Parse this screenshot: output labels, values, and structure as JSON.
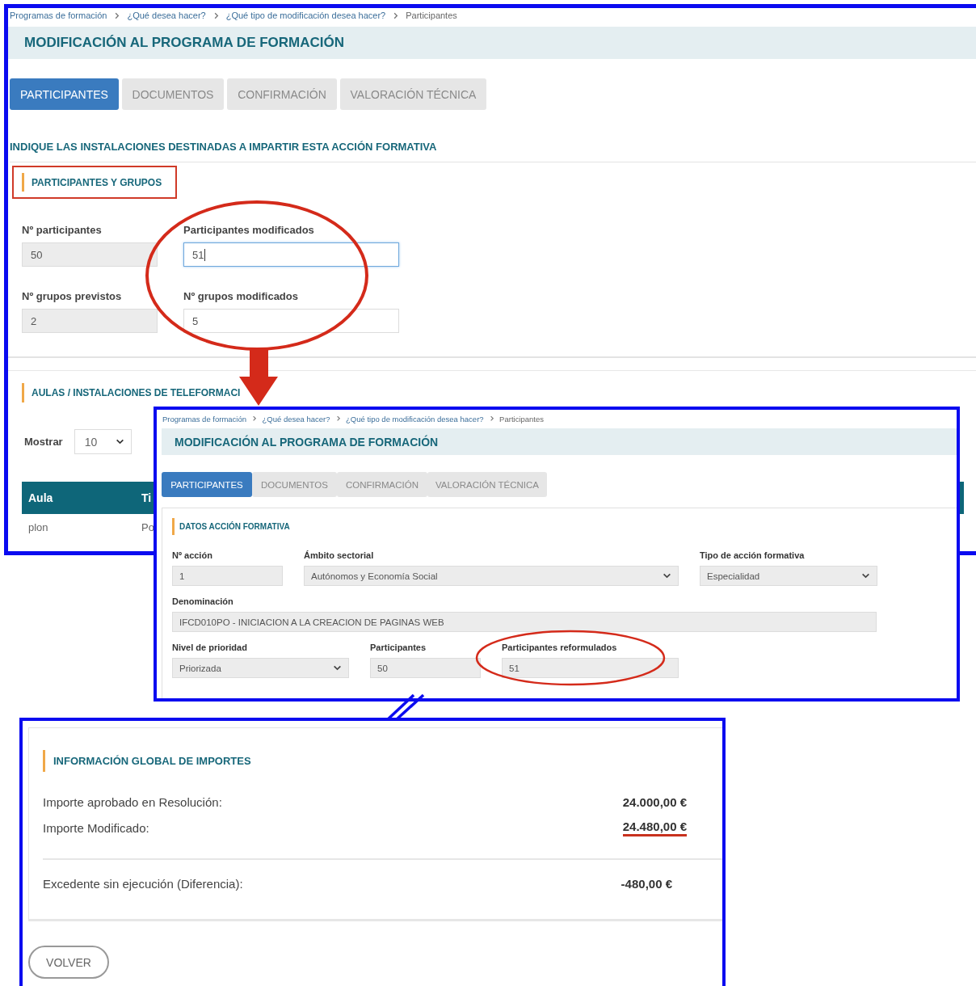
{
  "participants_screen": {
    "breadcrumb": [
      "Programas de formación",
      "¿Qué desea hacer?",
      "¿Qué tipo de modificación desea hacer?",
      "Participantes"
    ],
    "title": "MODIFICACIÓN AL PROGRAMA DE FORMACIÓN",
    "tabs": [
      {
        "label": "PARTICIPANTES",
        "selected": true
      },
      {
        "label": "DOCUMENTOS",
        "selected": false
      },
      {
        "label": "CONFIRMACIÓN",
        "selected": false
      },
      {
        "label": "VALORACIÓN TÉCNICA",
        "selected": false
      }
    ],
    "instruction": "INDIQUE LAS INSTALACIONES DESTINADAS A IMPARTIR ESTA ACCIÓN FORMATIVA",
    "groups_section": {
      "title": "PARTICIPANTES Y GRUPOS",
      "fields": [
        {
          "label": "Nº participantes",
          "value": "50",
          "disabled": true,
          "focused": false
        },
        {
          "label": "Participantes modificados",
          "value": "51",
          "disabled": false,
          "focused": true
        },
        {
          "label": "Nº grupos previstos",
          "value": "2",
          "disabled": true,
          "focused": false
        },
        {
          "label": "Nº grupos modificados",
          "value": "5",
          "disabled": false,
          "focused": false
        }
      ]
    },
    "rooms_section": {
      "title": "AULAS / INSTALACIONES DE TELEFORMACI",
      "show_label": "Mostrar",
      "page_size": "10",
      "table": {
        "columns": [
          "Aula",
          "Ti"
        ],
        "rows": [
          [
            "plon",
            "Po"
          ]
        ]
      }
    }
  },
  "action_screen": {
    "breadcrumb": [
      "Programas de formación",
      "¿Qué desea hacer?",
      "¿Qué tipo de modificación desea hacer?",
      "Participantes"
    ],
    "title": "MODIFICACIÓN AL PROGRAMA DE FORMACIÓN",
    "tabs": [
      {
        "label": "PARTICIPANTES",
        "selected": true
      },
      {
        "label": "DOCUMENTOS",
        "selected": false
      },
      {
        "label": "CONFIRMACIÓN",
        "selected": false
      },
      {
        "label": "VALORACIÓN TÉCNICA",
        "selected": false
      }
    ],
    "section_title": "DATOS ACCIÓN FORMATIVA",
    "fields": [
      {
        "label": "Nº acción",
        "value": "1",
        "kind": "input"
      },
      {
        "label": "Ámbito sectorial",
        "value": "Autónomos y Economía Social",
        "kind": "select"
      },
      {
        "label": "Tipo de acción formativa",
        "value": "Especialidad",
        "kind": "select"
      },
      {
        "label": "Denominación",
        "value": "IFCD010PO - INICIACION A LA CREACION DE PAGINAS WEB",
        "kind": "input"
      },
      {
        "label": "Nivel de prioridad",
        "value": "Priorizada",
        "kind": "select"
      },
      {
        "label": "Participantes",
        "value": "50",
        "kind": "input"
      },
      {
        "label": "Participantes reformulados",
        "value": "51",
        "kind": "input"
      }
    ]
  },
  "amounts_screen": {
    "section_title": "INFORMACIÓN GLOBAL DE IMPORTES",
    "rows": [
      {
        "label": "Importe aprobado en Resolución:",
        "value": "24.000,00 €",
        "highlighted": false
      },
      {
        "label": "Importe Modificado:",
        "value": "24.480,00 €",
        "highlighted": true
      }
    ],
    "difference": {
      "label": "Excedente sin ejecución (Diferencia):",
      "value": "-480,00 €"
    },
    "back_button": "VOLVER"
  }
}
